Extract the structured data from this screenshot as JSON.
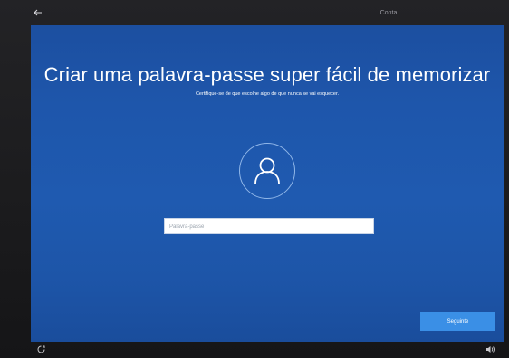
{
  "header": {
    "back_icon": "back-arrow-icon",
    "step_label": "Conta"
  },
  "main": {
    "title": "Criar uma palavra-passe super fácil de memorizar",
    "subtitle": "Certifique-se de que escolhe algo de que nunca se vai esquecer.",
    "avatar_icon": "user-icon"
  },
  "password": {
    "value": "",
    "placeholder": "Palavra-passe"
  },
  "footer": {
    "next_label": "Seguinte",
    "ease_of_access_icon": "ease-of-access-icon",
    "volume_icon": "volume-icon"
  },
  "colors": {
    "background": "#1f5ab0",
    "accent_button": "#3a8fe6",
    "text": "#ffffff"
  }
}
